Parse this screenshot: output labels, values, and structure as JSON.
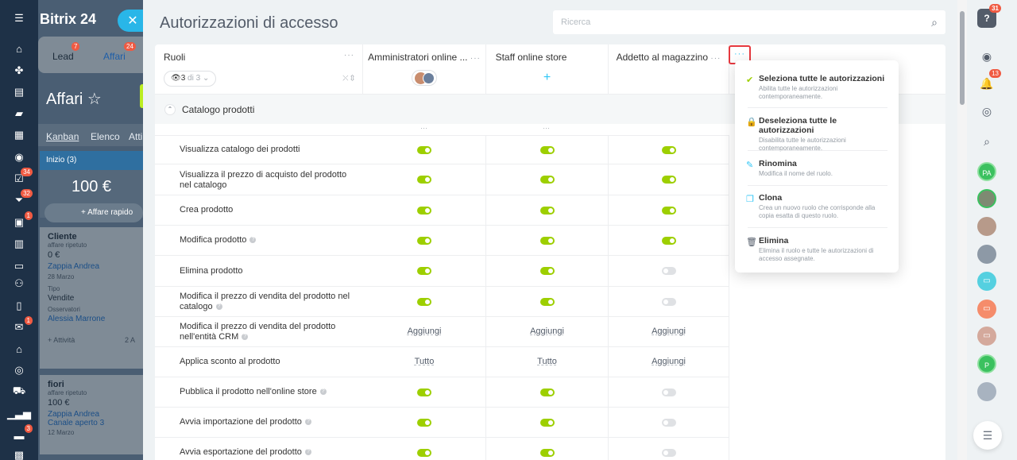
{
  "bg": {
    "logo": "Bitrix",
    "logo_num": "24",
    "tabs": [
      {
        "label": "Lead",
        "badge": "7"
      },
      {
        "label": "Affari",
        "badge": "24"
      }
    ],
    "title": "Affari",
    "views": [
      "Kanban",
      "Elenco",
      "Atti"
    ],
    "column": {
      "name": "Inizio",
      "count": "(3)",
      "sum": "100 €",
      "quick": "Affare rapido"
    },
    "card1": {
      "title": "Cliente",
      "sub": "affare ripetuto",
      "amount": "0 €",
      "contact": "Zappia Andrea",
      "date": "28 Marzo",
      "type_label": "Tipo",
      "type": "Vendite",
      "obs_label": "Osservatori",
      "obs": "Alessia Marrone",
      "activity": "+ Attività",
      "activity_count": "2 A"
    },
    "card2": {
      "title": "fiori",
      "sub": "affare ripetuto",
      "amount": "100 €",
      "contact": "Zappia Andrea",
      "extra": "Canale aperto 3",
      "date": "12 Marzo"
    },
    "nav_badges": {
      "tasks": "34",
      "filter": "32",
      "inbox": "1",
      "mail": "1",
      "cart": "3"
    }
  },
  "page": {
    "title": "Autorizzazioni di accesso",
    "search_placeholder": "Ricerca"
  },
  "roles": {
    "label": "Ruoli",
    "selected": "3",
    "of": "di 3"
  },
  "columns": [
    {
      "name": "Amministratori online ..."
    },
    {
      "name": "Staff online store"
    },
    {
      "name": "Addetto al magazzino"
    }
  ],
  "section": {
    "label": "Catalogo prodotti"
  },
  "rows": [
    {
      "label": "Visualizza catalogo dei prodotti",
      "values": [
        "on",
        "on",
        "on"
      ]
    },
    {
      "label": "Visualizza il prezzo di acquisto del prodotto nel catalogo",
      "values": [
        "on",
        "on",
        "on"
      ]
    },
    {
      "label": "Crea prodotto",
      "values": [
        "on",
        "on",
        "on"
      ]
    },
    {
      "label": "Modifica prodotto",
      "values": [
        "on",
        "on",
        "on"
      ],
      "help": true
    },
    {
      "label": "Elimina prodotto",
      "values": [
        "on",
        "on",
        "off"
      ]
    },
    {
      "label": "Modifica il prezzo di vendita del prodotto nel catalogo",
      "values": [
        "on",
        "on",
        "off"
      ],
      "help": true
    },
    {
      "label": "Modifica il prezzo di vendita del prodotto nell'entità CRM",
      "values": [
        "Aggiungi",
        "Aggiungi",
        "Aggiungi"
      ],
      "help": true
    },
    {
      "label": "Applica sconto al prodotto",
      "values": [
        "Tutto",
        "Tutto",
        "Aggiungi"
      ]
    },
    {
      "label": "Pubblica il prodotto nell'online store",
      "values": [
        "on",
        "on",
        "off"
      ],
      "help": true
    },
    {
      "label": "Avvia importazione del prodotto",
      "values": [
        "on",
        "on",
        "off"
      ],
      "help": true
    },
    {
      "label": "Avvia esportazione del prodotto",
      "values": [
        "on",
        "on",
        "off"
      ],
      "help": true
    }
  ],
  "menu": [
    {
      "title": "Seleziona tutte le autorizzazioni",
      "desc": "Abilita tutte le autorizzazioni contemporaneamente.",
      "icon": "check-icon"
    },
    {
      "title": "Deseleziona tutte le autorizzazioni",
      "desc": "Disabilita tutte le autorizzazioni contemporaneamente.",
      "icon": "lock-icon"
    },
    {
      "title": "Rinomina",
      "desc": "Modifica il nome del ruolo.",
      "icon": "pencil-icon"
    },
    {
      "title": "Clona",
      "desc": "Crea un nuovo ruolo che corrisponde alla copia esatta di questo ruolo.",
      "icon": "copy-icon"
    },
    {
      "title": "Elimina",
      "desc": "Elimina il ruolo e tutte le autorizzazioni di accesso assegnate.",
      "icon": "trash-icon"
    }
  ],
  "rightbar": {
    "help_badge": "31",
    "notif_badge": "13",
    "avatar_pa": "PA",
    "avatar_p": "P"
  },
  "colors": {
    "accent": "#2fc6f6",
    "toggle_on": "#9dcf00",
    "highlight": "#e6393f"
  }
}
